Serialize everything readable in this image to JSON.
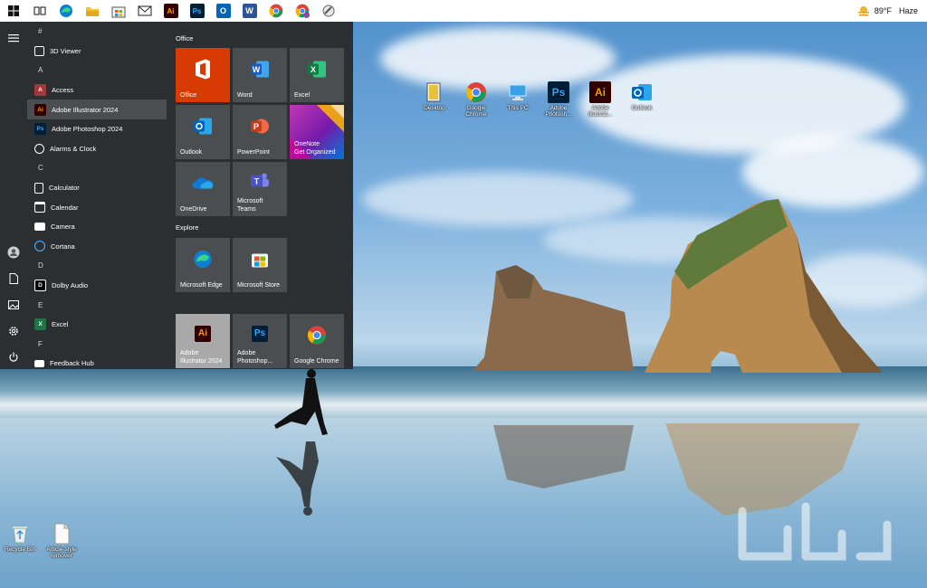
{
  "taskbar": {
    "items": [
      {
        "name": "start-button",
        "icon": "windows-logo-icon"
      },
      {
        "name": "task-view-button",
        "icon": "task-view-icon"
      },
      {
        "name": "edge-taskbar-button",
        "icon": "edge-icon"
      },
      {
        "name": "file-explorer-taskbar-button",
        "icon": "folder-icon"
      },
      {
        "name": "store-taskbar-button",
        "icon": "store-icon"
      },
      {
        "name": "mail-taskbar-button",
        "icon": "mail-icon"
      },
      {
        "name": "illustrator-taskbar-button",
        "icon": "illustrator-icon"
      },
      {
        "name": "photoshop-taskbar-button",
        "icon": "photoshop-icon"
      },
      {
        "name": "outlook-taskbar-button",
        "icon": "outlook-icon"
      },
      {
        "name": "word-taskbar-button",
        "icon": "word-icon"
      },
      {
        "name": "chrome-taskbar-button",
        "icon": "chrome-icon"
      },
      {
        "name": "chrome-profile-taskbar-button",
        "icon": "chrome-profile-icon"
      },
      {
        "name": "other-taskbar-button",
        "icon": "app-icon"
      }
    ],
    "weather": {
      "temp": "89°F",
      "condition": "Haze"
    }
  },
  "start_menu": {
    "app_list": [
      {
        "type": "header",
        "text": "#"
      },
      {
        "type": "app",
        "text": "3D Viewer",
        "icon": "3d-viewer-icon"
      },
      {
        "type": "header",
        "text": "A"
      },
      {
        "type": "app",
        "text": "Access",
        "icon": "access-icon"
      },
      {
        "type": "app",
        "text": "Adobe Illustrator 2024",
        "icon": "illustrator-icon",
        "selected": true
      },
      {
        "type": "app",
        "text": "Adobe Photoshop 2024",
        "icon": "photoshop-icon"
      },
      {
        "type": "app",
        "text": "Alarms & Clock",
        "icon": "alarm-clock-icon"
      },
      {
        "type": "header",
        "text": "C"
      },
      {
        "type": "app",
        "text": "Calculator",
        "icon": "calculator-icon"
      },
      {
        "type": "app",
        "text": "Calendar",
        "icon": "calendar-icon"
      },
      {
        "type": "app",
        "text": "Camera",
        "icon": "camera-icon"
      },
      {
        "type": "app",
        "text": "Cortana",
        "icon": "cortana-icon"
      },
      {
        "type": "header",
        "text": "D"
      },
      {
        "type": "app",
        "text": "Dolby Audio",
        "icon": "dolby-icon"
      },
      {
        "type": "header",
        "text": "E"
      },
      {
        "type": "app",
        "text": "Excel",
        "icon": "excel-icon"
      },
      {
        "type": "header",
        "text": "F"
      },
      {
        "type": "app",
        "text": "Feedback Hub",
        "icon": "feedback-icon"
      }
    ],
    "groups": {
      "office": "Office",
      "explore": "Explore"
    },
    "tiles": {
      "office": "Office",
      "word": "Word",
      "excel": "Excel",
      "outlook": "Outlook",
      "powerpoint": "PowerPoint",
      "onenote_1": "OneNote",
      "onenote_2": "Get Organized",
      "onedrive": "OneDrive",
      "teams_1": "Microsoft",
      "teams_2": "Teams",
      "edge": "Microsoft Edge",
      "store": "Microsoft Store",
      "illustrator_1": "Adobe",
      "illustrator_2": "Illustrator 2024",
      "photoshop_1": "Adobe",
      "photoshop_2": "Photoshop...",
      "chrome": "Google Chrome"
    }
  },
  "desktop": {
    "icons": [
      {
        "label": "Desktop",
        "icon": "desktop-folder-icon"
      },
      {
        "label": "Google Chrome",
        "icon": "chrome-icon"
      },
      {
        "label": "This PC",
        "icon": "this-pc-icon"
      },
      {
        "label": "Adobe Photosh...",
        "icon": "photoshop-icon"
      },
      {
        "label": "Adobe Illustrat...",
        "icon": "illustrator-icon"
      },
      {
        "label": "Outlook",
        "icon": "outlook-icon"
      },
      {
        "label": "Recycle Bin",
        "icon": "recycle-bin-icon"
      },
      {
        "label": "Article-style remover",
        "icon": "document-icon"
      }
    ]
  },
  "colors": {
    "office_red": "#d83b01",
    "word_blue": "#2b579a",
    "excel_green": "#217346",
    "outlook_blue": "#0078d4",
    "ps_bg": "#001e36",
    "ps_fg": "#31a8ff",
    "ai_bg": "#330000",
    "ai_fg": "#ff9a00",
    "tile_gray": "#4a4e50",
    "menu_bg": "#2b2f31"
  }
}
